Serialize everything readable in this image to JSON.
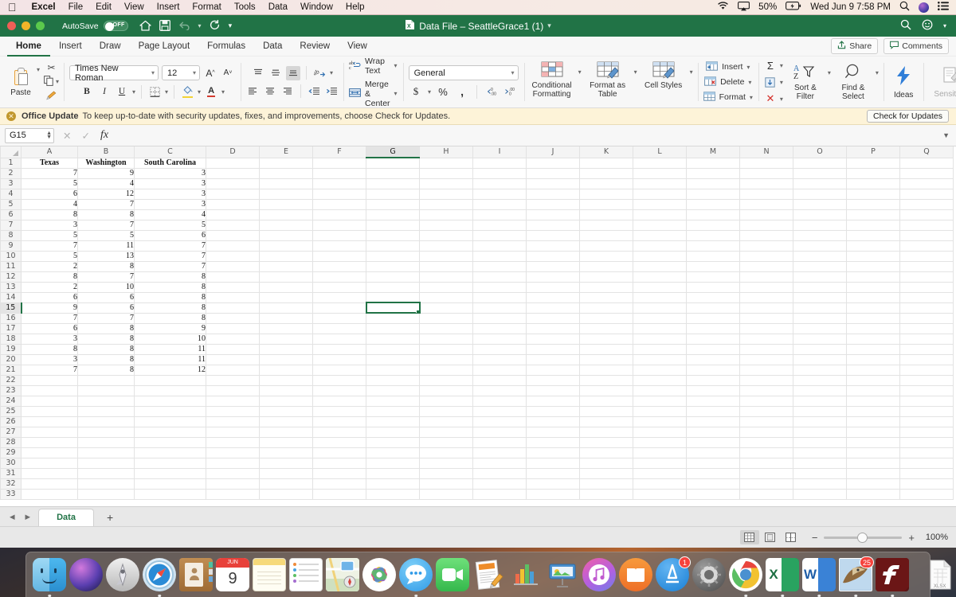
{
  "mac_menu": {
    "apple": "apple-logo",
    "items": [
      "Excel",
      "File",
      "Edit",
      "View",
      "Insert",
      "Format",
      "Tools",
      "Data",
      "Window",
      "Help"
    ],
    "status": {
      "wifi": "wifi-icon",
      "airplay": "airplay-icon",
      "battery_pct": "50%",
      "battery": "battery-charging-icon",
      "datetime": "Wed Jun 9  7:58 PM",
      "search": "search-icon",
      "siri": "siri-icon",
      "control_center": "control-center-icon"
    }
  },
  "titlebar": {
    "autosave_label": "AutoSave",
    "autosave_state": "OFF",
    "quick_access": [
      "home-icon",
      "save-icon",
      "undo-icon",
      "undo-chevron",
      "redo-icon",
      "customize-chevron"
    ],
    "document_title": "Data File – SeattleGrace1 (1)",
    "title_chevron": "chevron-down-icon",
    "right_icons": [
      "search-icon",
      "smiley-icon",
      "chevron-down-icon"
    ],
    "accent": "#217346"
  },
  "ribbon": {
    "tabs": [
      {
        "label": "Home",
        "active": true
      },
      {
        "label": "Insert",
        "active": false
      },
      {
        "label": "Draw",
        "active": false
      },
      {
        "label": "Page Layout",
        "active": false
      },
      {
        "label": "Formulas",
        "active": false
      },
      {
        "label": "Data",
        "active": false
      },
      {
        "label": "Review",
        "active": false
      },
      {
        "label": "View",
        "active": false
      }
    ],
    "share_label": "Share",
    "comments_label": "Comments",
    "clipboard": {
      "paste_label": "Paste",
      "cut": "scissors-icon",
      "copy": "copy-icon",
      "format_painter": "format-painter-icon"
    },
    "font": {
      "family": "Times New Roman",
      "size": "12",
      "grow": "A",
      "shrink": "A",
      "bold": "B",
      "italic": "I",
      "underline": "U",
      "borders": "borders-icon",
      "fill_color": "fill-color-icon",
      "font_color": "A"
    },
    "alignment": {
      "top": "align-top-icon",
      "middle": "align-middle-icon",
      "bottom": "align-bottom-icon",
      "orientation": "orientation-icon",
      "left": "align-left-icon",
      "center": "align-center-icon",
      "right": "align-right-icon",
      "decrease_indent": "decrease-indent-icon",
      "increase_indent": "increase-indent-icon",
      "wrap_text": "Wrap Text",
      "merge_center": "Merge & Center"
    },
    "number": {
      "format": "General",
      "currency": "$",
      "percent": "%",
      "comma": ",",
      "increase_decimal": "increase-decimal-icon",
      "decrease_decimal": "decrease-decimal-icon"
    },
    "styles": {
      "conditional_formatting": "Conditional Formatting",
      "format_as_table": "Format as Table",
      "cell_styles": "Cell Styles"
    },
    "cells": {
      "insert": "Insert",
      "delete": "Delete",
      "format": "Format"
    },
    "editing": {
      "autosum": "Σ",
      "fill": "fill-down-icon",
      "clear": "clear-icon",
      "sort_filter": "Sort & Filter",
      "find_select": "Find & Select"
    },
    "ideas_label": "Ideas",
    "sensitivity_label": "Sensitivity"
  },
  "banner": {
    "title": "Office Update",
    "message": "To keep up-to-date with security updates, fixes, and improvements, choose Check for Updates.",
    "button": "Check for Updates",
    "close": "close-icon"
  },
  "formula_bar": {
    "name_box": "G15",
    "cancel": "cancel-icon",
    "confirm": "confirm-icon",
    "function": "fx",
    "value": "",
    "expand": "expand-chevron-icon"
  },
  "sheet": {
    "columns": [
      "A",
      "B",
      "C",
      "D",
      "E",
      "F",
      "G",
      "H",
      "I",
      "J",
      "K",
      "L",
      "M",
      "N",
      "O",
      "P",
      "Q"
    ],
    "selected_column": "G",
    "selected_row": 15,
    "selected_cell": "G15",
    "total_rows": 33,
    "headers": [
      "Texas",
      "Washington",
      "South Carolina"
    ],
    "data": [
      [
        7,
        9,
        3
      ],
      [
        5,
        4,
        3
      ],
      [
        6,
        12,
        3
      ],
      [
        4,
        7,
        3
      ],
      [
        8,
        8,
        4
      ],
      [
        3,
        7,
        5
      ],
      [
        5,
        5,
        6
      ],
      [
        7,
        11,
        7
      ],
      [
        5,
        13,
        7
      ],
      [
        2,
        8,
        7
      ],
      [
        8,
        7,
        8
      ],
      [
        2,
        10,
        8
      ],
      [
        6,
        6,
        8
      ],
      [
        9,
        6,
        8
      ],
      [
        7,
        7,
        8
      ],
      [
        6,
        8,
        9
      ],
      [
        3,
        8,
        10
      ],
      [
        8,
        8,
        11
      ],
      [
        3,
        8,
        11
      ],
      [
        7,
        8,
        12
      ]
    ]
  },
  "tabbar": {
    "prev": "previous-sheet-icon",
    "next": "next-sheet-icon",
    "sheets": [
      "Data"
    ],
    "active_sheet": "Data",
    "add": "+"
  },
  "statusbar": {
    "views": [
      "normal-view-icon",
      "page-layout-icon",
      "page-break-icon"
    ],
    "active_view": "normal-view-icon",
    "zoom_out": "−",
    "zoom_in": "+",
    "zoom_level": "100%"
  },
  "dock": {
    "items": [
      {
        "name": "finder",
        "running": true
      },
      {
        "name": "siri",
        "running": false
      },
      {
        "name": "launchpad",
        "running": false
      },
      {
        "name": "safari",
        "running": true
      },
      {
        "name": "contacts",
        "running": false
      },
      {
        "name": "calendar",
        "running": false,
        "label": "JUN",
        "day": "9"
      },
      {
        "name": "notes",
        "running": false
      },
      {
        "name": "reminders",
        "running": false
      },
      {
        "name": "maps",
        "running": false
      },
      {
        "name": "photos",
        "running": false
      },
      {
        "name": "messages",
        "running": true
      },
      {
        "name": "facetime",
        "running": false
      },
      {
        "name": "pages",
        "running": false
      },
      {
        "name": "numbers",
        "running": false
      },
      {
        "name": "keynote",
        "running": false
      },
      {
        "name": "itunes",
        "running": false
      },
      {
        "name": "ibooks",
        "running": false
      },
      {
        "name": "app-store",
        "running": false,
        "badge": "1"
      },
      {
        "name": "system-preferences",
        "running": false
      },
      {
        "name": "chrome",
        "running": true
      },
      {
        "name": "excel",
        "running": true
      },
      {
        "name": "word",
        "running": true
      },
      {
        "name": "mail",
        "running": true,
        "badge": "25"
      },
      {
        "name": "flash-player",
        "running": true
      }
    ],
    "files": [
      {
        "name": "xlsx-document",
        "label": "XLSX"
      },
      {
        "name": "word-document"
      },
      {
        "name": "presentation-document"
      },
      {
        "name": "trash"
      }
    ]
  }
}
